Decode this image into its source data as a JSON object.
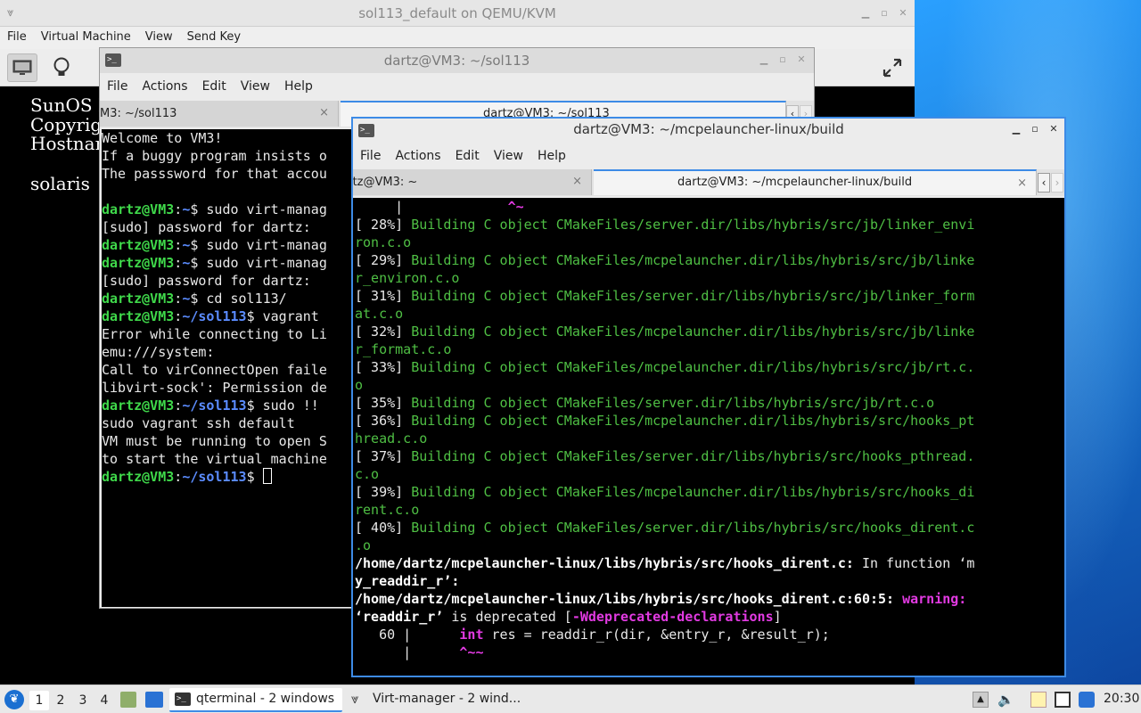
{
  "qemu": {
    "title": "sol113_default on QEMU/KVM",
    "menu": [
      "File",
      "Virtual Machine",
      "View",
      "Send Key"
    ],
    "console_lines": [
      "SunOS R",
      "Copyrig",
      "Hostnam",
      "",
      "solaris"
    ]
  },
  "term1": {
    "title": "dartz@VM3: ~/sol113",
    "menu": [
      "File",
      "Actions",
      "Edit",
      "View",
      "Help"
    ],
    "tabs": [
      {
        "label": "M3: ~/sol113",
        "close": "×"
      },
      {
        "label": "dartz@VM3: ~/sol113"
      }
    ],
    "lines": [
      "Welcome to VM3!",
      "If a buggy program insists o",
      "The passsword for that accou",
      "",
      "~$ sudo virt-manag",
      "[sudo] password for dartz:",
      "~$ sudo virt-manag",
      "~$ sudo virt-manag",
      "[sudo] password for dartz:",
      "~$ cd sol113/",
      "$ vagrant",
      "Error while connecting to Li",
      "emu:///system:",
      "Call to virConnectOpen faile",
      "libvirt-sock': Permission de",
      "$ sudo !!",
      "sudo vagrant ssh default",
      "VM must be running to open S",
      "to start the virtual machine",
      "$ "
    ],
    "prompt_user": "dartz@VM3",
    "prompt_sep": ":",
    "prompt_path_home": "~",
    "prompt_path_dir": "~/sol113"
  },
  "term2": {
    "title": "dartz@VM3: ~/mcpelauncher-linux/build",
    "menu": [
      "File",
      "Actions",
      "Edit",
      "View",
      "Help"
    ],
    "tabs": [
      {
        "label": "dartz@VM3: ~",
        "close": "×"
      },
      {
        "label": "dartz@VM3: ~/mcpelauncher-linux/build",
        "close": "×"
      }
    ],
    "lines": [
      {
        "t": "     |             ^~",
        "c": "caret"
      },
      {
        "p": "[ 28%]",
        "t": " Building C object CMakeFiles/server.dir/libs/hybris/src/jb/linker_envi"
      },
      {
        "p": "",
        "t": "ron.c.o"
      },
      {
        "p": "[ 29%]",
        "t": " Building C object CMakeFiles/mcpelauncher.dir/libs/hybris/src/jb/linke"
      },
      {
        "p": "",
        "t": "r_environ.c.o"
      },
      {
        "p": "[ 31%]",
        "t": " Building C object CMakeFiles/server.dir/libs/hybris/src/jb/linker_form"
      },
      {
        "p": "",
        "t": "at.c.o"
      },
      {
        "p": "[ 32%]",
        "t": " Building C object CMakeFiles/mcpelauncher.dir/libs/hybris/src/jb/linke"
      },
      {
        "p": "",
        "t": "r_format.c.o"
      },
      {
        "p": "[ 33%]",
        "t": " Building C object CMakeFiles/mcpelauncher.dir/libs/hybris/src/jb/rt.c."
      },
      {
        "p": "",
        "t": "o"
      },
      {
        "p": "[ 35%]",
        "t": " Building C object CMakeFiles/server.dir/libs/hybris/src/jb/rt.c.o"
      },
      {
        "p": "[ 36%]",
        "t": " Building C object CMakeFiles/mcpelauncher.dir/libs/hybris/src/hooks_pt"
      },
      {
        "p": "",
        "t": "hread.c.o"
      },
      {
        "p": "[ 37%]",
        "t": " Building C object CMakeFiles/server.dir/libs/hybris/src/hooks_pthread."
      },
      {
        "p": "",
        "t": "c.o"
      },
      {
        "p": "[ 39%]",
        "t": " Building C object CMakeFiles/mcpelauncher.dir/libs/hybris/src/hooks_di"
      },
      {
        "p": "",
        "t": "rent.c.o"
      },
      {
        "p": "[ 40%]",
        "t": " Building C object CMakeFiles/server.dir/libs/hybris/src/hooks_dirent.c"
      },
      {
        "p": "",
        "t": ".o"
      }
    ],
    "warn_path1": "/home/dartz/mcpelauncher-linux/libs/hybris/src/hooks_dirent.c:",
    "warn_in_function": " In function ‘m",
    "warn_fn_tail": "y_readdir_r’:",
    "warn_path2": "/home/dartz/mcpelauncher-linux/libs/hybris/src/hooks_dirent.c:60:5:",
    "warn_label": " warning:",
    "warn_msg_a": "‘readdir_r’",
    "warn_msg_b": " is deprecated [",
    "warn_flag": "-Wdeprecated-declarations",
    "warn_msg_c": "]",
    "code_lineno": "   60 |      ",
    "code_kw": "int",
    "code_rest": " res = readdir_r(dir, &entry_r, &result_r);",
    "code_caret_bar": "      |      ",
    "code_caret": "^~~"
  },
  "taskbar": {
    "workspaces": [
      "1",
      "2",
      "3",
      "4"
    ],
    "tasks": [
      {
        "label": "qterminal - 2 windows"
      },
      {
        "label": "Virt-manager - 2 wind..."
      }
    ],
    "clock": "20:30"
  }
}
